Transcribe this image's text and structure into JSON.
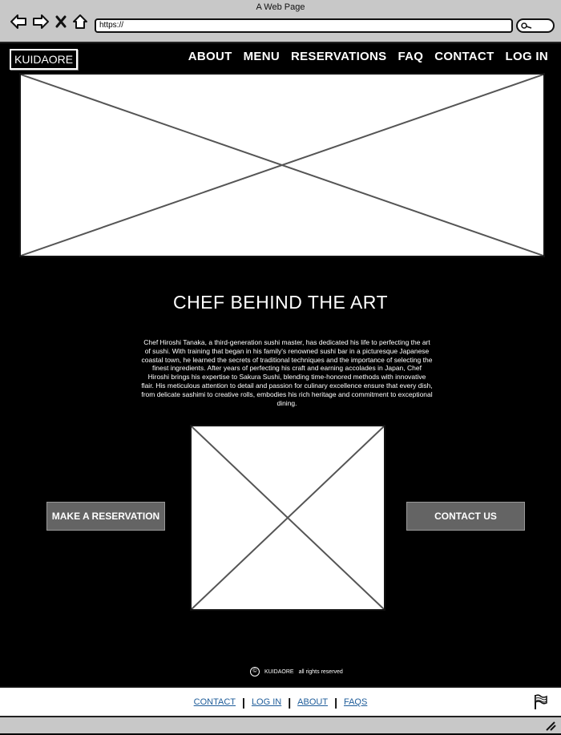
{
  "browser": {
    "window_title": "A Web Page",
    "address": "https://"
  },
  "header": {
    "logo": "KUIDAORE",
    "nav": [
      "ABOUT",
      "MENU",
      "RESERVATIONS",
      "FAQ",
      "CONTACT",
      "LOG IN"
    ]
  },
  "about": {
    "title": "CHEF BEHIND THE ART",
    "bio": "Chef Hiroshi Tanaka, a third-generation sushi master, has dedicated his life to perfecting the art of sushi. With training that began in his family's renowned sushi bar in a picturesque Japanese coastal town, he learned the secrets of traditional techniques and the importance of selecting the finest ingredients. After years of perfecting his craft and earning accolades in Japan, Chef Hiroshi brings his expertise to Sakura Sushi, blending time-honored methods with innovative flair. His meticulous attention to detail and passion for culinary excellence ensure that every dish, from delicate sashimi to creative rolls, embodies his rich heritage and commitment to exceptional dining."
  },
  "cta": {
    "reservation": "MAKE A RESERVATION",
    "contact": "CONTACT US"
  },
  "copyright": {
    "symbol": "©",
    "brand": "KUIDAORE",
    "text": "all rights reserved"
  },
  "footer": {
    "links": [
      "CONTACT",
      "LOG IN",
      "ABOUT",
      "FAQS"
    ]
  },
  "icons": [
    "back-arrow-icon",
    "forward-arrow-icon",
    "close-icon",
    "home-icon",
    "search-icon",
    "flag-icon",
    "resize-grip-icon"
  ]
}
